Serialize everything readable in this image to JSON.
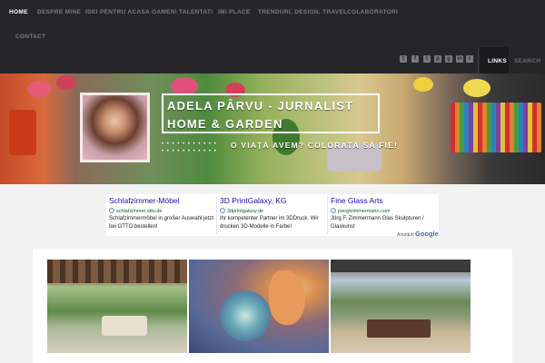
{
  "nav": {
    "items": [
      {
        "label": "HOME",
        "active": true
      },
      {
        "label": "DESPRE MINE"
      },
      {
        "label": "IDEI PENTRU ACASA"
      },
      {
        "label": "OAMENI TALENTATI"
      },
      {
        "label": "IMI PLACE"
      },
      {
        "label": "TRENDURI, DESIGN, TRAVEL"
      },
      {
        "label": "COLABORATORI"
      },
      {
        "label": "CONTACT"
      }
    ],
    "social_icons": [
      "twitter-icon",
      "facebook-icon",
      "tumblr-icon",
      "pinterest-icon",
      "googleplus-icon",
      "linkedin-icon",
      "rss-icon"
    ],
    "links_label": "LINKS",
    "search_label": "SEARCH"
  },
  "header": {
    "title": "ADELA PÂRVU - JURNALIST HOME & GARDEN",
    "tagline": "O VIAȚĂ AVEM? COLORATĂ SĂ FIE!"
  },
  "ads": {
    "items": [
      {
        "title": "Schlafzimmer-Möbel",
        "url": "schlafzimmer.otto.de",
        "description": "Schlafzimmermöbel in großer Auswahl jetzt bei OTTO bestellen!"
      },
      {
        "title": "3D PrintGalaxy, KG",
        "url": "3dprintgalaxy.de",
        "description": "Ihr kompetenter Partner im 3DDruck. Wir drucken 3D-Modelle in Farbe!"
      },
      {
        "title": "Fine Glass Arts",
        "url": "joergfzimmermann.com",
        "description": "Jörg F. Zimmermann Glas Skulpturen / Glaskunst"
      }
    ],
    "footer_label": "Anunțuri",
    "footer_brand": "Google"
  },
  "colors": {
    "nav_bg": "#262629",
    "nav_text": "#7b7b80",
    "ad_title": "#1a0dab",
    "ad_url": "#006621"
  }
}
